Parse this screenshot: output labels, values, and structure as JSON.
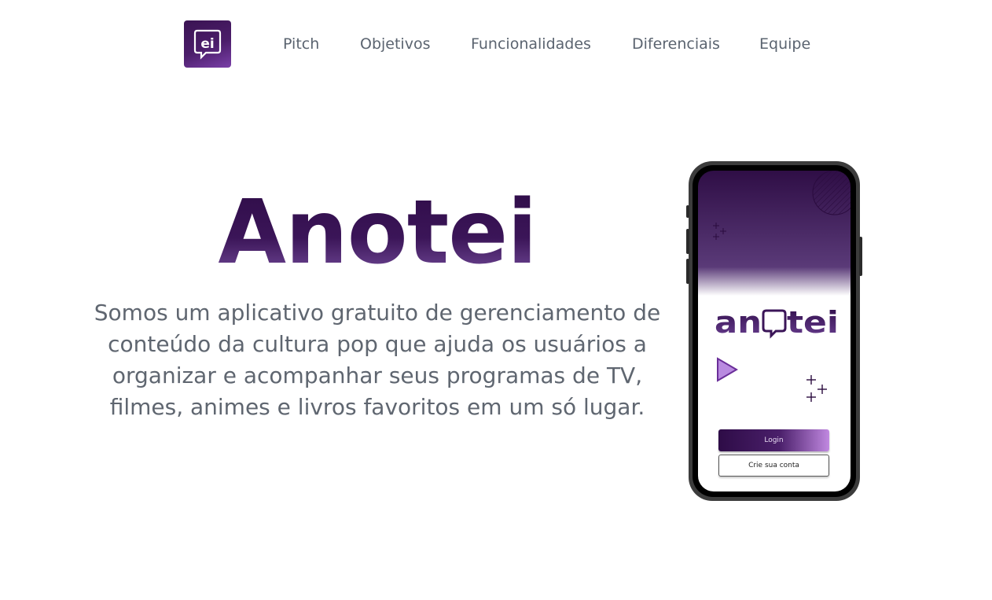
{
  "logo": {
    "text": "ei",
    "icon": "ei-speech-bubble-logo"
  },
  "nav": {
    "items": [
      {
        "label": "Pitch"
      },
      {
        "label": "Objetivos"
      },
      {
        "label": "Funcionalidades"
      },
      {
        "label": "Diferenciais"
      },
      {
        "label": "Equipe"
      }
    ]
  },
  "hero": {
    "title": "Anotei",
    "description": "Somos um aplicativo gratuito de gerenciamento de conteúdo da cultura pop que ajuda os usuários a organizar e acompanhar seus programas de TV, filmes, animes e livros favoritos em um só lugar."
  },
  "phone": {
    "app_name": "anotei",
    "login_label": "Login",
    "create_account_label": "Crie sua conta",
    "icons": [
      "sparkle-icon",
      "play-triangle-icon",
      "striped-circle-decoration"
    ]
  },
  "colors": {
    "brand_dark": "#2e0c47",
    "brand_mid": "#4b1d6a",
    "brand_light": "#c088e0",
    "text_muted": "#5f6670"
  }
}
